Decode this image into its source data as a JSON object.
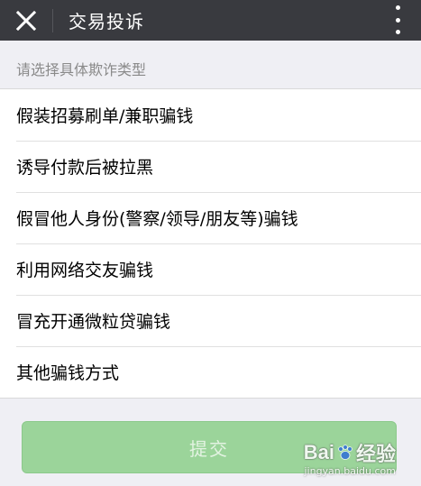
{
  "header": {
    "title": "交易投诉",
    "close_icon": "close-icon",
    "more_icon": "more-vertical-icon"
  },
  "section": {
    "hint": "请选择具体欺诈类型"
  },
  "items": [
    {
      "label": "假装招募刷单/兼职骗钱"
    },
    {
      "label": "诱导付款后被拉黑"
    },
    {
      "label": "假冒他人身份(警察/领导/朋友等)骗钱"
    },
    {
      "label": "利用网络交友骗钱"
    },
    {
      "label": "冒充开通微粒贷骗钱"
    },
    {
      "label": "其他骗钱方式"
    }
  ],
  "submit": {
    "label": "提交"
  },
  "watermark": {
    "logo_left": "Bai",
    "logo_right": "经验",
    "url": "jingyan.baidu.com"
  },
  "colors": {
    "header_bg": "#393a3f",
    "page_bg": "#efeff4",
    "submit_bg": "#9bd49a"
  }
}
